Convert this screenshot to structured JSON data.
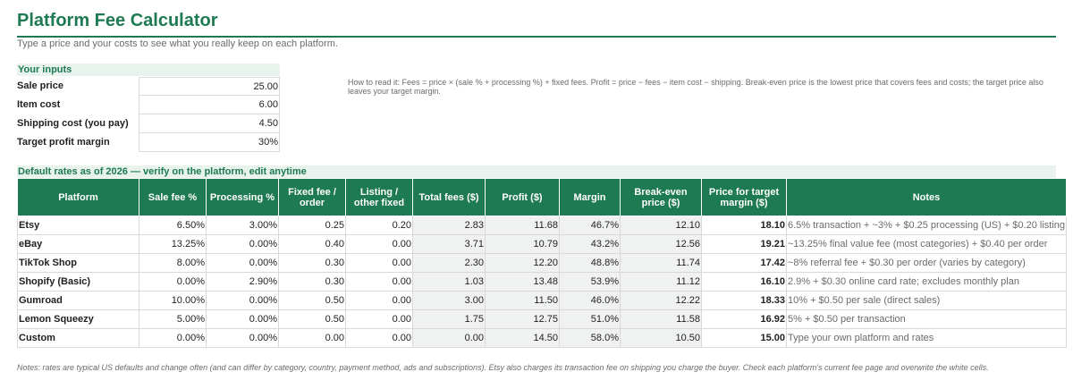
{
  "title": "Platform Fee Calculator",
  "subtitle": "Type a price and your costs to see what you really keep on each platform.",
  "inputs": {
    "header": "Your inputs",
    "rows": [
      {
        "label": "Sale price",
        "value": "25.00"
      },
      {
        "label": "Item cost",
        "value": "6.00"
      },
      {
        "label": "Shipping cost (you pay)",
        "value": "4.50"
      },
      {
        "label": "Target profit margin",
        "value": "30%"
      }
    ]
  },
  "howto": "How to read it: Fees = price × (sale % + processing %) + fixed fees. Profit = price − fees − item cost − shipping. Break-even price is the lowest price that covers fees and costs; the target price also leaves your target margin.",
  "rates_header": "Default rates as of 2026 — verify on the platform, edit anytime",
  "table": {
    "columns": [
      "Platform",
      "Sale fee %",
      "Processing %",
      "Fixed fee / order",
      "Listing / other fixed",
      "Total fees ($)",
      "Profit ($)",
      "Margin",
      "Break-even price ($)",
      "Price for target margin ($)",
      "Notes"
    ],
    "rows": [
      {
        "platform": "Etsy",
        "sale_fee": "6.50%",
        "processing": "3.00%",
        "fixed": "0.25",
        "listing": "0.20",
        "total_fees": "2.83",
        "profit": "11.68",
        "margin": "46.7%",
        "break_even": "12.10",
        "target": "18.10",
        "notes": "6.5% transaction + ~3% + $0.25 processing (US) + $0.20 listing"
      },
      {
        "platform": "eBay",
        "sale_fee": "13.25%",
        "processing": "0.00%",
        "fixed": "0.40",
        "listing": "0.00",
        "total_fees": "3.71",
        "profit": "10.79",
        "margin": "43.2%",
        "break_even": "12.56",
        "target": "19.21",
        "notes": "~13.25% final value fee (most categories) + $0.40 per order"
      },
      {
        "platform": "TikTok Shop",
        "sale_fee": "8.00%",
        "processing": "0.00%",
        "fixed": "0.30",
        "listing": "0.00",
        "total_fees": "2.30",
        "profit": "12.20",
        "margin": "48.8%",
        "break_even": "11.74",
        "target": "17.42",
        "notes": "~8% referral fee + $0.30 per order (varies by category)"
      },
      {
        "platform": "Shopify (Basic)",
        "sale_fee": "0.00%",
        "processing": "2.90%",
        "fixed": "0.30",
        "listing": "0.00",
        "total_fees": "1.03",
        "profit": "13.48",
        "margin": "53.9%",
        "break_even": "11.12",
        "target": "16.10",
        "notes": "2.9% + $0.30 online card rate; excludes monthly plan"
      },
      {
        "platform": "Gumroad",
        "sale_fee": "10.00%",
        "processing": "0.00%",
        "fixed": "0.50",
        "listing": "0.00",
        "total_fees": "3.00",
        "profit": "11.50",
        "margin": "46.0%",
        "break_even": "12.22",
        "target": "18.33",
        "notes": "10% + $0.50 per sale (direct sales)"
      },
      {
        "platform": "Lemon Squeezy",
        "sale_fee": "5.00%",
        "processing": "0.00%",
        "fixed": "0.50",
        "listing": "0.00",
        "total_fees": "1.75",
        "profit": "12.75",
        "margin": "51.0%",
        "break_even": "11.58",
        "target": "16.92",
        "notes": "5% + $0.50 per transaction"
      },
      {
        "platform": "Custom",
        "sale_fee": "0.00%",
        "processing": "0.00%",
        "fixed": "0.00",
        "listing": "0.00",
        "total_fees": "0.00",
        "profit": "14.50",
        "margin": "58.0%",
        "break_even": "10.50",
        "target": "15.00",
        "notes": "Type your own platform and rates"
      }
    ]
  },
  "footnote": "Notes: rates are typical US defaults and change often (and can differ by category, country, payment method, ads and subscriptions). Etsy also charges its transaction fee on shipping you charge the buyer. Check each platform's current fee page and overwrite the white cells.",
  "colors": {
    "accent": "#1e7a52",
    "section_bg": "#e7f3ec",
    "calc_bg": "#f0f2f1"
  }
}
